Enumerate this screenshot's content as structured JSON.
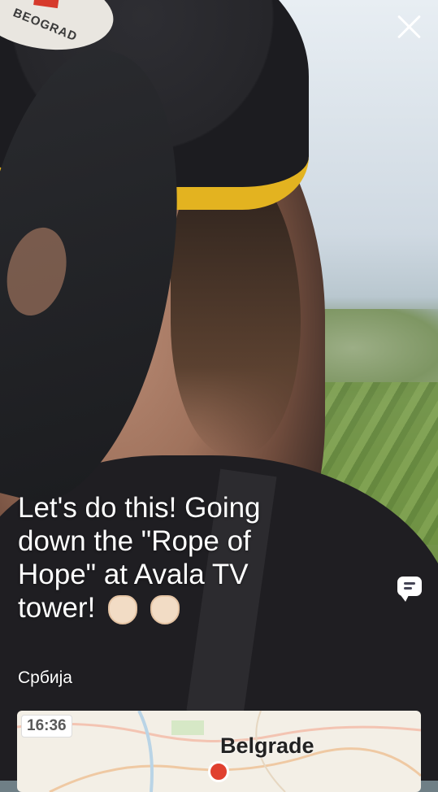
{
  "stream": {
    "caption_line1": "Let's do this! Going",
    "caption_line2": "down the \"Rope of",
    "caption_line3": "Hope\" at Avala TV",
    "caption_line4": "tower!",
    "location": "Србија",
    "helmet_text": "BEOGRAD"
  },
  "map": {
    "time": "16:36",
    "city": "Belgrade"
  },
  "icons": {
    "close": "close-icon",
    "chat": "chat-bubble-icon",
    "emoji": "raised-fist-emoji"
  },
  "colors": {
    "text": "#ffffff",
    "pin": "#e0402f",
    "helmet": "#e3b320"
  }
}
